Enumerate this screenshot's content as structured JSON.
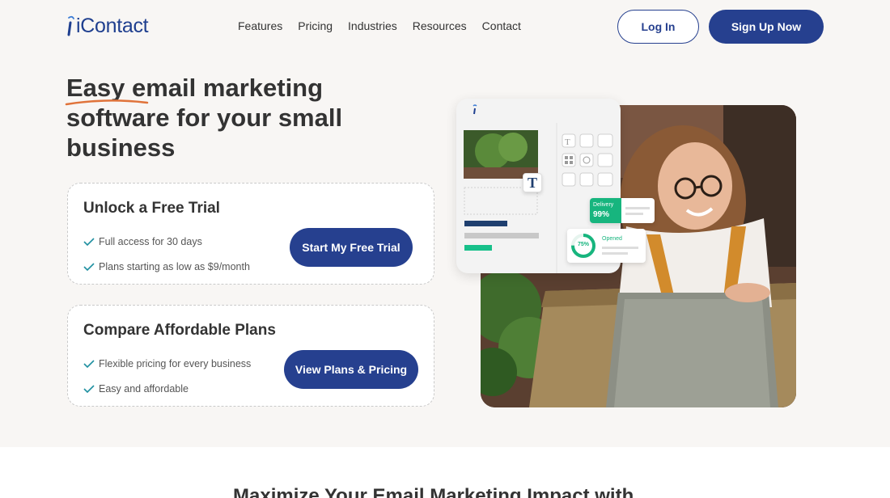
{
  "header": {
    "logo_text": "iContact",
    "nav": [
      "Features",
      "Pricing",
      "Industries",
      "Resources",
      "Contact"
    ],
    "login_label": "Log In",
    "signup_label": "Sign Up Now"
  },
  "hero": {
    "title": "Easy email marketing software for your small business"
  },
  "cards": [
    {
      "title": "Unlock a Free Trial",
      "items": [
        "Full access for 30 days",
        "Plans starting as low as $9/month"
      ],
      "button": "Start My Free Trial"
    },
    {
      "title": "Compare Affordable Plans",
      "items": [
        "Flexible pricing for every business",
        "Easy and affordable"
      ],
      "button": "View Plans & Pricing"
    }
  ],
  "illustration": {
    "delivery_label": "Delivery",
    "delivery_value": "99%",
    "opened_label": "Opened",
    "opened_value": "75%",
    "editor_text_icon": "T"
  },
  "bottom": {
    "heading": "Maximize Your Email Marketing Impact with"
  },
  "colors": {
    "brand_blue": "#26408f",
    "accent_orange": "#e0733a",
    "check_teal": "#1e8fa0",
    "green": "#17b57e"
  }
}
